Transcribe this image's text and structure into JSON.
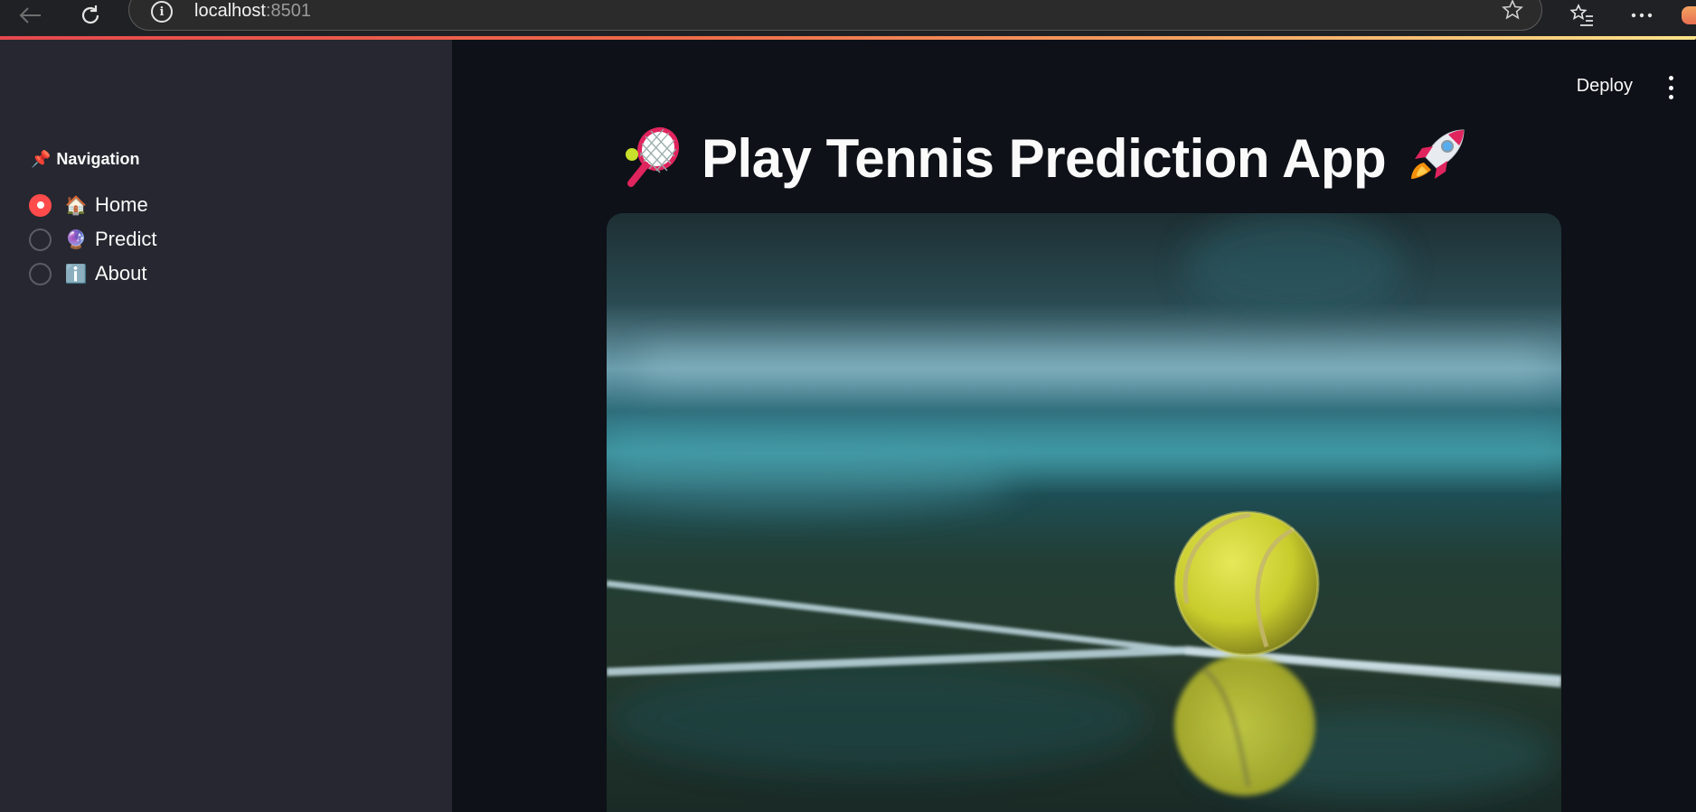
{
  "browser": {
    "url_host": "localhost",
    "url_port": ":8501",
    "info_icon": "info-icon",
    "back_icon": "back-arrow-icon",
    "reload_icon": "reload-icon",
    "favorite_icon": "star-icon",
    "favorites_icon": "favorites-list-icon",
    "more_icon": "more-horizontal-icon"
  },
  "sidebar": {
    "title_emoji": "📌",
    "title": "Navigation",
    "selected_index": 0,
    "items": [
      {
        "emoji": "🏠",
        "label": "Home"
      },
      {
        "emoji": "🔮",
        "label": "Predict"
      },
      {
        "emoji": "ℹ️",
        "label": "About"
      }
    ]
  },
  "header": {
    "deploy_label": "Deploy"
  },
  "main": {
    "title_left_emoji": "🎾",
    "title": "Play Tennis Prediction App",
    "title_right_emoji": "🚀",
    "hero_image": "tennis-ball-on-court-photo"
  },
  "colors": {
    "accent": "#ff4b4b",
    "sidebar_bg": "#262730",
    "main_bg": "#0e1117",
    "text": "#fafafa"
  }
}
